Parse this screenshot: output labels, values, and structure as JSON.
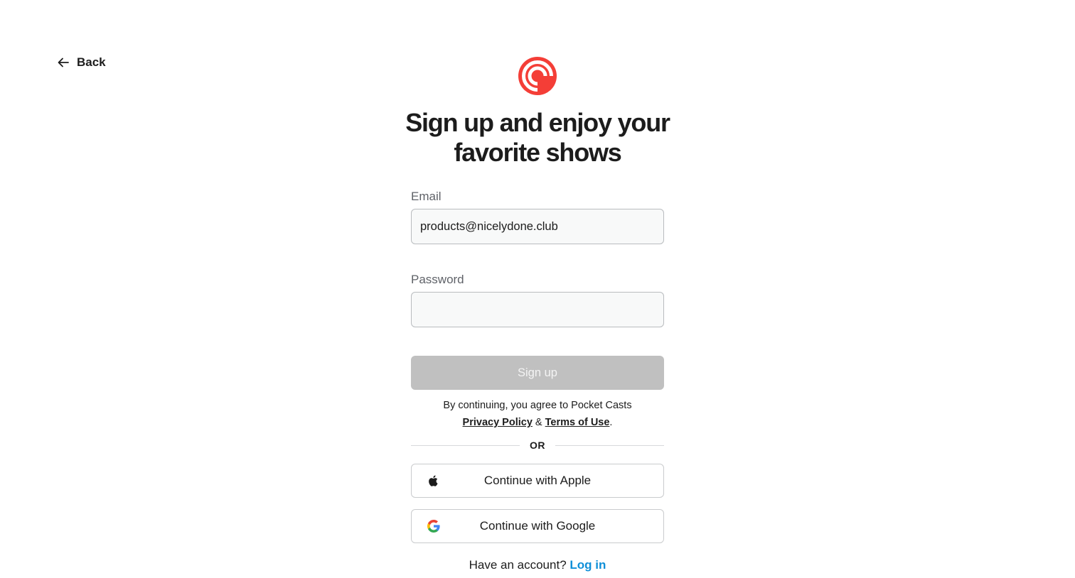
{
  "nav": {
    "back_label": "Back",
    "back_icon": "arrow-left-icon"
  },
  "brand": {
    "logo_icon": "pocket-casts-logo",
    "color": "#F43E37"
  },
  "heading": {
    "line1": "Sign up and enjoy your",
    "line2": "favorite shows"
  },
  "form": {
    "email_label": "Email",
    "email_value": "products@nicelydone.club",
    "password_label": "Password",
    "password_value": "",
    "submit_label": "Sign up",
    "submit_color": "#C0C0C0"
  },
  "terms": {
    "prefix": "By continuing, you agree to Pocket Casts",
    "privacy": "Privacy Policy",
    "joiner": "&",
    "tos": "Terms of Use",
    "suffix": "."
  },
  "divider": {
    "label": "OR"
  },
  "social": {
    "apple_label": "Continue with Apple",
    "apple_icon": "apple-icon",
    "google_label": "Continue with Google",
    "google_icon": "google-icon"
  },
  "footer": {
    "prompt": "Have an account?",
    "login_label": "Log in",
    "link_color": "#0F8FD8"
  }
}
